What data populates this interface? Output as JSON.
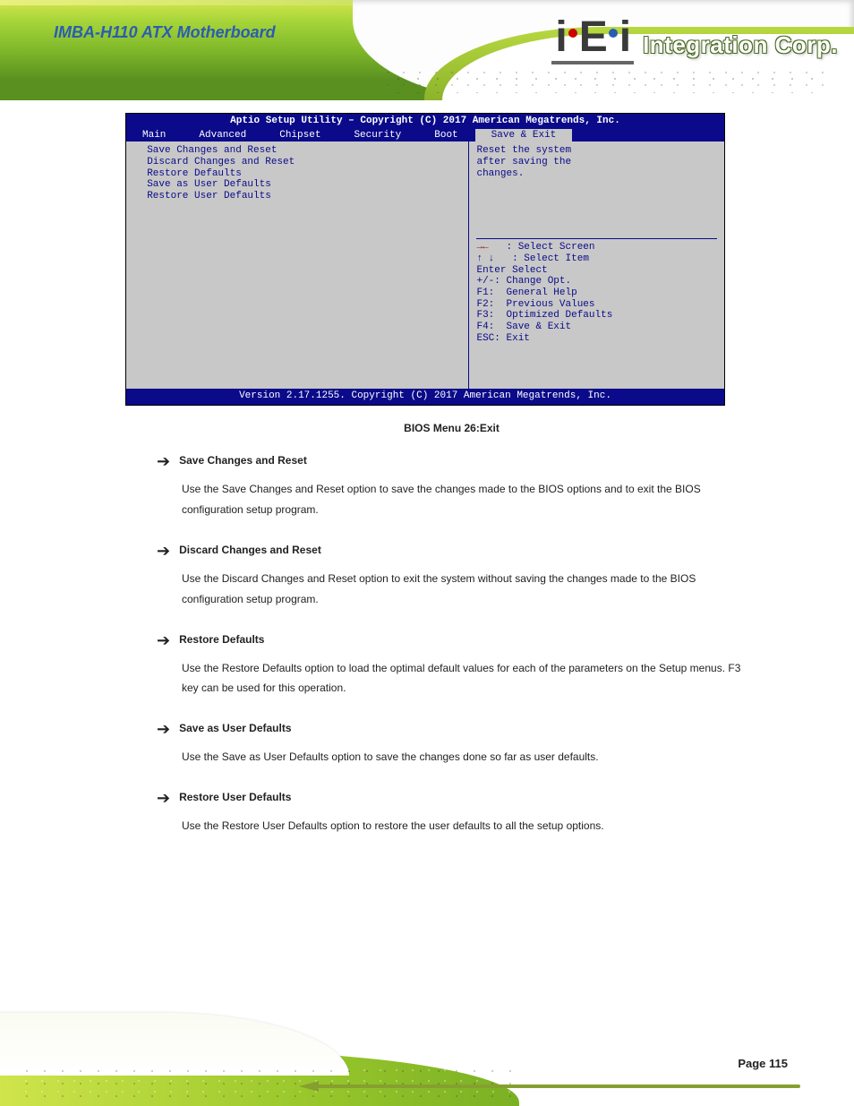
{
  "header": {
    "doc_title": "IMBA-H110 ATX Motherboard",
    "brand_text": "Integration Corp.",
    "logo_text": "iEi"
  },
  "bios": {
    "setup_title": "Aptio Setup Utility – Copyright (C) 2017 American Megatrends, Inc.",
    "tabs": {
      "main": "Main",
      "advanced": "Advanced",
      "chipset": "Chipset",
      "security": "Security",
      "boot": "Boot",
      "save_exit": "Save & Exit"
    },
    "left_lines": [
      "  Save Changes and Reset",
      "  Discard Changes and Reset",
      "",
      "  Restore Defaults",
      "  Save as User Defaults",
      "  Restore User Defaults"
    ],
    "right_hint_top": [
      "Reset the system",
      "after saving the",
      "changes."
    ],
    "help_lines": [
      "   : Select Screen",
      "   : Select Item",
      "Enter Select",
      "+/-: Change Opt.",
      "F1:  General Help",
      "F2:  Previous Values",
      "F3:  Optimized Defaults",
      "F4:  Save & Exit",
      "ESC: Exit"
    ],
    "footer": "Version 2.17.1255. Copyright (C) 2017 American Megatrends, Inc."
  },
  "caption": "BIOS Menu 26:Exit",
  "entries": [
    {
      "title": "Save Changes and Reset",
      "body": "Use the Save Changes and Reset option to save the changes made to the BIOS options and to exit the BIOS configuration setup program."
    },
    {
      "title": "Discard Changes and Reset",
      "body": "Use the Discard Changes and Reset option to exit the system without saving the changes made to the BIOS configuration setup program."
    },
    {
      "title": "Restore Defaults",
      "body": "Use the Restore Defaults option to load the optimal default values for each of the parameters on the Setup menus. F3 key can be used for this operation."
    },
    {
      "title": "Save as User Defaults",
      "body": "Use the Save as User Defaults option to save the changes done so far as user defaults."
    },
    {
      "title": "Restore User Defaults",
      "body": "Use the Restore User Defaults option to restore the user defaults to all the setup options."
    }
  ],
  "footer": {
    "page_number": "Page 115"
  },
  "arrows": {
    "lr_chars": "→←",
    "ud_chars": "↑ ↓"
  }
}
